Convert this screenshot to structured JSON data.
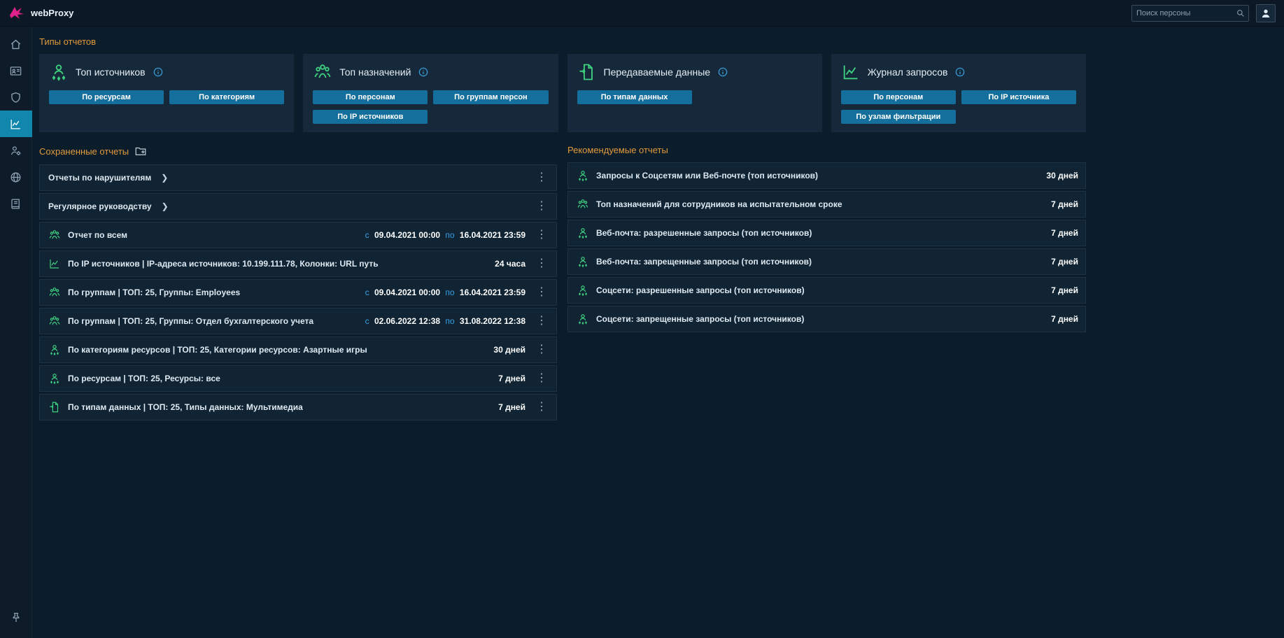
{
  "topbar": {
    "app_title": "webProxy",
    "search_placeholder": "Поиск персоны"
  },
  "report_types": {
    "section_title": "Типы отчетов",
    "cards": [
      {
        "title": "Топ источников",
        "buttons": [
          "По ресурсам",
          "По категориям"
        ]
      },
      {
        "title": "Топ назначений",
        "buttons": [
          "По персонам",
          "По группам персон",
          "По IP источников"
        ]
      },
      {
        "title": "Передаваемые данные",
        "buttons": [
          "По типам данных"
        ]
      },
      {
        "title": "Журнал запросов",
        "buttons": [
          "По персонам",
          "По IP источника",
          "По узлам фильтрации"
        ]
      }
    ]
  },
  "saved_reports": {
    "section_title": "Сохраненные отчеты",
    "folders": [
      {
        "label": "Отчеты по нарушителям"
      },
      {
        "label": "Регулярное руководству"
      }
    ],
    "items": [
      {
        "label": "Отчет по всем",
        "from_label": "с",
        "from": "09.04.2021 00:00",
        "to_label": "по",
        "to": "16.04.2021 23:59"
      },
      {
        "label": "По IP источников | IP-адреса источников: 10.199.111.78, Колонки: URL путь",
        "period": "24 часа"
      },
      {
        "label": "По группам | ТОП: 25, Группы: Employees",
        "from_label": "с",
        "from": "09.04.2021 00:00",
        "to_label": "по",
        "to": "16.04.2021 23:59"
      },
      {
        "label": "По группам | ТОП: 25, Группы: Отдел бухгалтерского учета",
        "from_label": "с",
        "from": "02.06.2022 12:38",
        "to_label": "по",
        "to": "31.08.2022 12:38"
      },
      {
        "label": "По категориям ресурсов | ТОП: 25, Категории ресурсов: Азартные игры",
        "period": "30 дней"
      },
      {
        "label": "По ресурсам | ТОП: 25, Ресурсы: все",
        "period": "7 дней"
      },
      {
        "label": "По типам данных | ТОП: 25, Типы данных: Мультимедиа",
        "period": "7 дней"
      }
    ]
  },
  "recommended_reports": {
    "section_title": "Рекомендуемые отчеты",
    "items": [
      {
        "label": "Запросы к Соцсетям или Веб-почте (топ источников)",
        "period": "30 дней"
      },
      {
        "label": "Топ назначений для сотрудников на испытательном сроке",
        "period": "7 дней"
      },
      {
        "label": "Веб-почта: разрешенные запросы (топ источников)",
        "period": "7 дней"
      },
      {
        "label": "Веб-почта: запрещенные запросы (топ источников)",
        "period": "7 дней"
      },
      {
        "label": "Соцсети: разрешенные запросы (топ источников)",
        "period": "7 дней"
      },
      {
        "label": "Соцсети: запрещенные запросы (топ источников)",
        "period": "7 дней"
      }
    ]
  },
  "glyphs": {
    "kebab": "⋮",
    "chevron": "❯"
  },
  "colors": {
    "accent_orange": "#e29a3c",
    "accent_green": "#3ecf7f",
    "accent_blue": "#389fe5",
    "button_bg": "#156f9c",
    "active_sidebar": "#1187ae"
  }
}
